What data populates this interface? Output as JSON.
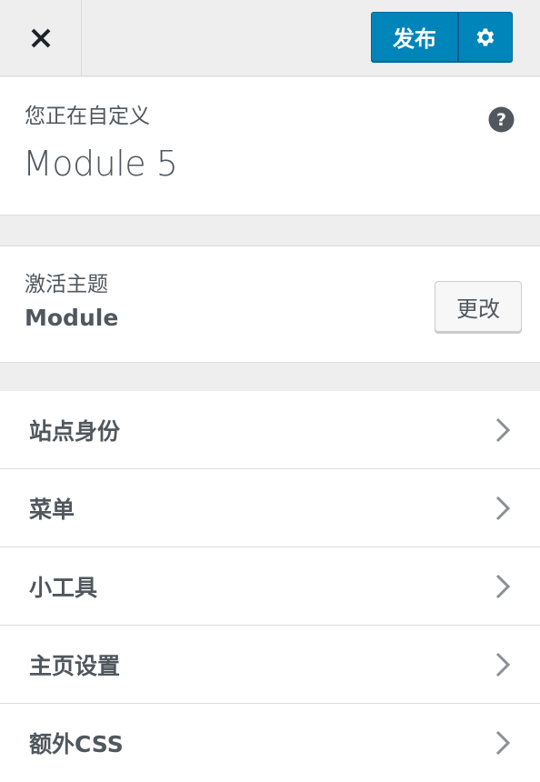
{
  "header": {
    "close_icon": "close-icon",
    "publish_label": "发布",
    "settings_icon": "gear-icon",
    "accent_color": "#0085ba"
  },
  "info": {
    "label": "您正在自定义",
    "title": "Module 5",
    "help_icon": "help-icon"
  },
  "theme": {
    "label": "激活主题",
    "name": "Module",
    "change_label": "更改"
  },
  "sections": {
    "items": [
      {
        "label": "站点身份"
      },
      {
        "label": "菜单"
      },
      {
        "label": "小工具"
      },
      {
        "label": "主页设置"
      },
      {
        "label": "额外CSS"
      }
    ],
    "chevron_icon": "chevron-right-icon"
  }
}
